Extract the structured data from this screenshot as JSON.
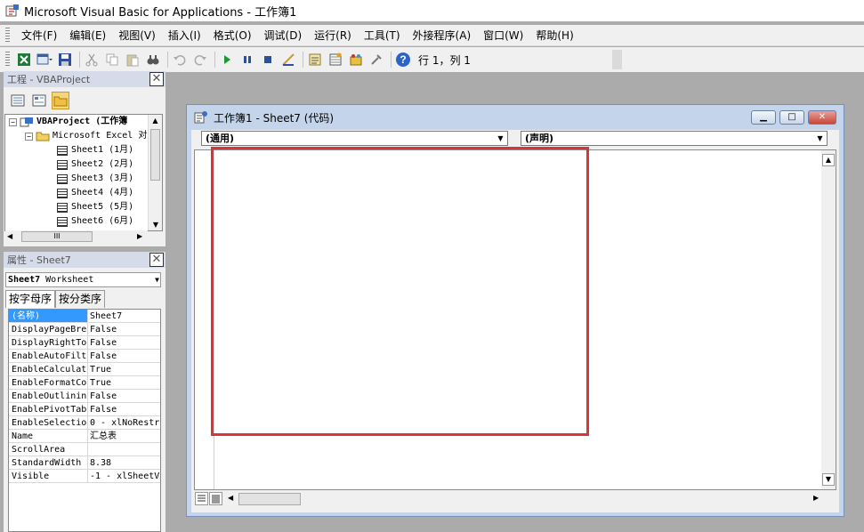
{
  "window": {
    "title": "Microsoft Visual Basic for Applications - 工作簿1"
  },
  "menu": [
    "文件(F)",
    "编辑(E)",
    "视图(V)",
    "插入(I)",
    "格式(O)",
    "调试(D)",
    "运行(R)",
    "工具(T)",
    "外接程序(A)",
    "窗口(W)",
    "帮助(H)"
  ],
  "toolbar": {
    "position": "行 1，列 1",
    "help_icon": "?"
  },
  "project": {
    "title": "工程 - VBAProject",
    "root": "VBAProject (工作簿",
    "folder": "Microsoft Excel 对",
    "sheets": [
      "Sheet1 (1月)",
      "Sheet2 (2月)",
      "Sheet3 (3月)",
      "Sheet4 (4月)",
      "Sheet5 (5月)",
      "Sheet6 (6月)"
    ],
    "scroll_mark": "III"
  },
  "properties": {
    "title": "属性 - Sheet7",
    "object_name": "Sheet7",
    "object_type": "Worksheet",
    "tabs": [
      "按字母序",
      "按分类序"
    ],
    "rows": [
      {
        "name": "(名称)",
        "value": "Sheet7"
      },
      {
        "name": "DisplayPageBre",
        "value": "False"
      },
      {
        "name": "DisplayRightTo",
        "value": "False"
      },
      {
        "name": "EnableAutoFilt",
        "value": "False"
      },
      {
        "name": "EnableCalculat",
        "value": "True"
      },
      {
        "name": "EnableFormatCo",
        "value": "True"
      },
      {
        "name": "EnableOutlinin",
        "value": "False"
      },
      {
        "name": "EnablePivotTab",
        "value": "False"
      },
      {
        "name": "EnableSelectio",
        "value": "0 - xlNoRestr"
      },
      {
        "name": "Name",
        "value": "汇总表"
      },
      {
        "name": "ScrollArea",
        "value": ""
      },
      {
        "name": "StandardWidth",
        "value": "8.38"
      },
      {
        "name": "Visible",
        "value": "-1 - xlSheetV"
      }
    ]
  },
  "code_window": {
    "title": "工作簿1 - Sheet7 (代码)",
    "object_combo": "(通用)",
    "procedure_combo": "(声明)"
  },
  "colors": {
    "highlight_box": "#d9343a",
    "selection": "#3399ff"
  }
}
